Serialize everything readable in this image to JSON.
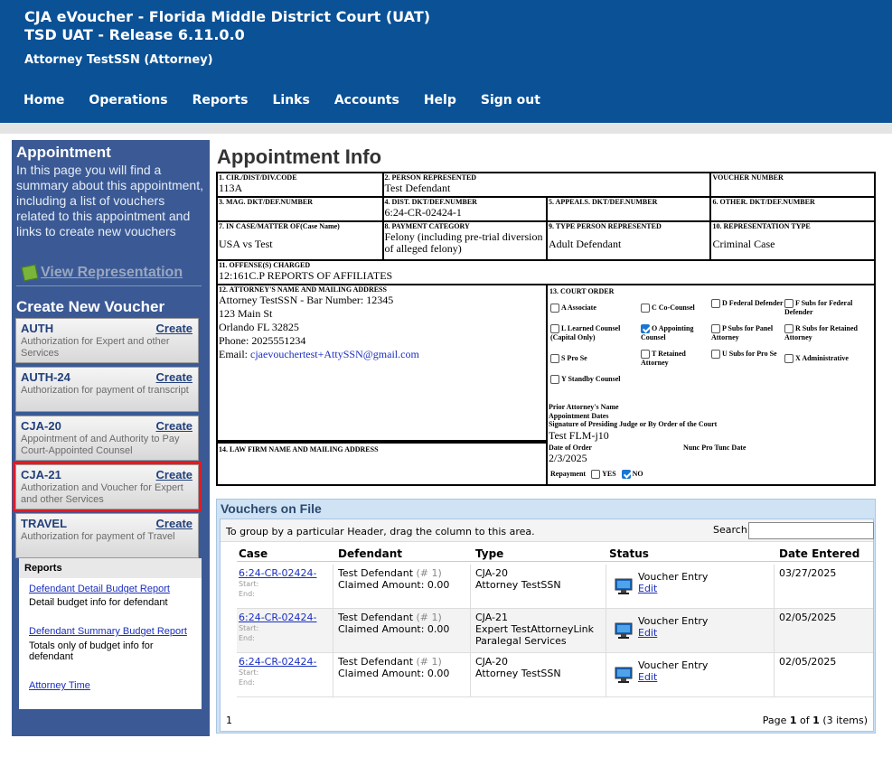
{
  "header": {
    "title_line1": "CJA eVoucher - Florida Middle District Court (UAT)",
    "title_line2": "TSD UAT - Release 6.11.0.0",
    "user": "Attorney TestSSN (Attorney)",
    "nav": [
      "Home",
      "Operations",
      "Reports",
      "Links",
      "Accounts",
      "Help",
      "Sign out"
    ],
    "bg_color": "#0a5196"
  },
  "sidebar": {
    "title": "Appointment",
    "description": "In this page you will find a summary about this appointment, including a list of vouchers related to this appointment and links to create new vouchers",
    "view_representation": "View Representation",
    "create_title": "Create New Voucher",
    "vouchers": [
      {
        "name": "AUTH",
        "create": "Create",
        "desc": "Authorization for Expert and other Services"
      },
      {
        "name": "AUTH-24",
        "create": "Create",
        "desc": "Authorization for payment of transcript"
      },
      {
        "name": "CJA-20",
        "create": "Create",
        "desc": "Appointment of and Authority to Pay Court-Appointed Counsel"
      },
      {
        "name": "CJA-21",
        "create": "Create",
        "desc": "Authorization and Voucher for Expert and other Services"
      },
      {
        "name": "TRAVEL",
        "create": "Create",
        "desc": "Authorization for payment of Travel"
      }
    ],
    "reports": {
      "title": "Reports",
      "items": [
        {
          "link": "Defendant Detail Budget Report",
          "desc": "Detail budget info for defendant"
        },
        {
          "link": "Defendant Summary Budget Report",
          "desc": "Totals only of budget info for defendant"
        },
        {
          "link": "Attorney Time",
          "desc": ""
        }
      ]
    },
    "highlight_color": "#e21b23"
  },
  "main": {
    "title": "Appointment Info",
    "form": {
      "f1_label": "1. CIR./DIST/DIV.CODE",
      "f1_value": "113A",
      "f2_label": "2. PERSON REPRESENTED",
      "f2_value": "Test Defendant",
      "voucher_number_label": "VOUCHER NUMBER",
      "f3_label": "3. MAG. DKT/DEF.NUMBER",
      "f4_label": "4. DIST. DKT/DEF.NUMBER",
      "f4_value": "6:24-CR-02424-1",
      "f5_label": "5. APPEALS. DKT/DEF.NUMBER",
      "f6_label": "6. OTHER. DKT/DEF.NUMBER",
      "f7_label": "7. IN CASE/MATTER OF(Case Name)",
      "f7_value": "USA vs Test",
      "f8_label": "8. PAYMENT CATEGORY",
      "f8_value": "Felony (including pre-trial diversion of alleged felony)",
      "f9_label": "9. TYPE PERSON REPRESENTED",
      "f9_value": "Adult Defendant",
      "f10_label": "10. REPRESENTATION TYPE",
      "f10_value": "Criminal Case",
      "f11_label": "11. OFFENSE(S) CHARGED",
      "f11_value": "12:161C.P REPORTS OF AFFILIATES",
      "f12_label": "12. ATTORNEY'S NAME AND MAILING ADDRESS",
      "f12_line1": "Attorney TestSSN - Bar Number: 12345",
      "f12_line2": "123 Main St",
      "f12_line3": "Orlando FL 32825",
      "f12_line4": "Phone: 2025551234",
      "f12_email_label": "Email: ",
      "f12_email": "cjaevouchertest+AttySSN@gmail.com",
      "f13_label": "13. COURT ORDER",
      "court_orders": {
        "a": "A Associate",
        "c": "C Co-Counsel",
        "d": "D Federal Defender",
        "f": "F Subs for Federal Defender",
        "l": "L Learned Counsel (Capital Only)",
        "o": "O Appointing Counsel",
        "p": "P Subs for Panel Attorney",
        "r": "R Subs for Retained Attorney",
        "s": "S Pro Se",
        "t": "T Retained Attorney",
        "u": "U Subs for Pro Se",
        "x": "X Administrative",
        "y": "Y Standby Counsel"
      },
      "prior_attorney": "Prior Attorney's Name",
      "appointment_dates": "Appointment Dates",
      "signature_label": "Signature of Presiding Judge or By Order of the Court",
      "signature_value": "Test FLM-j10",
      "date_of_order_label": "Date of Order",
      "nunc_pro_tunc_label": "Nunc Pro Tunc Date",
      "date_of_order_value": "2/3/2025",
      "repayment_label": "Repayment",
      "yes_label": "YES",
      "no_label": "NO",
      "f14_label": "14. LAW FIRM NAME AND MAILING ADDRESS"
    },
    "vouchers_on_file": {
      "title": "Vouchers on File",
      "group_hint": "To group by a particular Header, drag the column to this area.",
      "search_label": "Search:",
      "search_value": "",
      "columns": [
        "Case",
        "Defendant",
        "Type",
        "Status",
        "Date Entered"
      ],
      "rows": [
        {
          "case": "6:24-CR-02424-",
          "start": "Start:",
          "end": "End:",
          "defendant": "Test Defendant",
          "def_num": "(# 1)",
          "claimed": "Claimed Amount: 0.00",
          "type1": "CJA-20",
          "type2": "Attorney TestSSN",
          "type3": "",
          "status": "Voucher Entry",
          "edit": "Edit",
          "date": "03/27/2025"
        },
        {
          "case": "6:24-CR-02424-",
          "start": "Start:",
          "end": "End:",
          "defendant": "Test Defendant",
          "def_num": "(# 1)",
          "claimed": "Claimed Amount: 0.00",
          "type1": "CJA-21",
          "type2": "Expert TestAttorneyLink",
          "type3": "Paralegal Services",
          "status": "Voucher Entry",
          "edit": "Edit",
          "date": "02/05/2025"
        },
        {
          "case": "6:24-CR-02424-",
          "start": "Start:",
          "end": "End:",
          "defendant": "Test Defendant",
          "def_num": "(# 1)",
          "claimed": "Claimed Amount: 0.00",
          "type1": "CJA-20",
          "type2": "Attorney TestSSN",
          "type3": "",
          "status": "Voucher Entry",
          "edit": "Edit",
          "date": "02/05/2025"
        }
      ],
      "footer_page": "1",
      "footer_summary_prefix": "Page ",
      "footer_page_num": "1",
      "footer_of": " of ",
      "footer_total_pages": "1",
      "footer_items": " (3 items)"
    }
  }
}
